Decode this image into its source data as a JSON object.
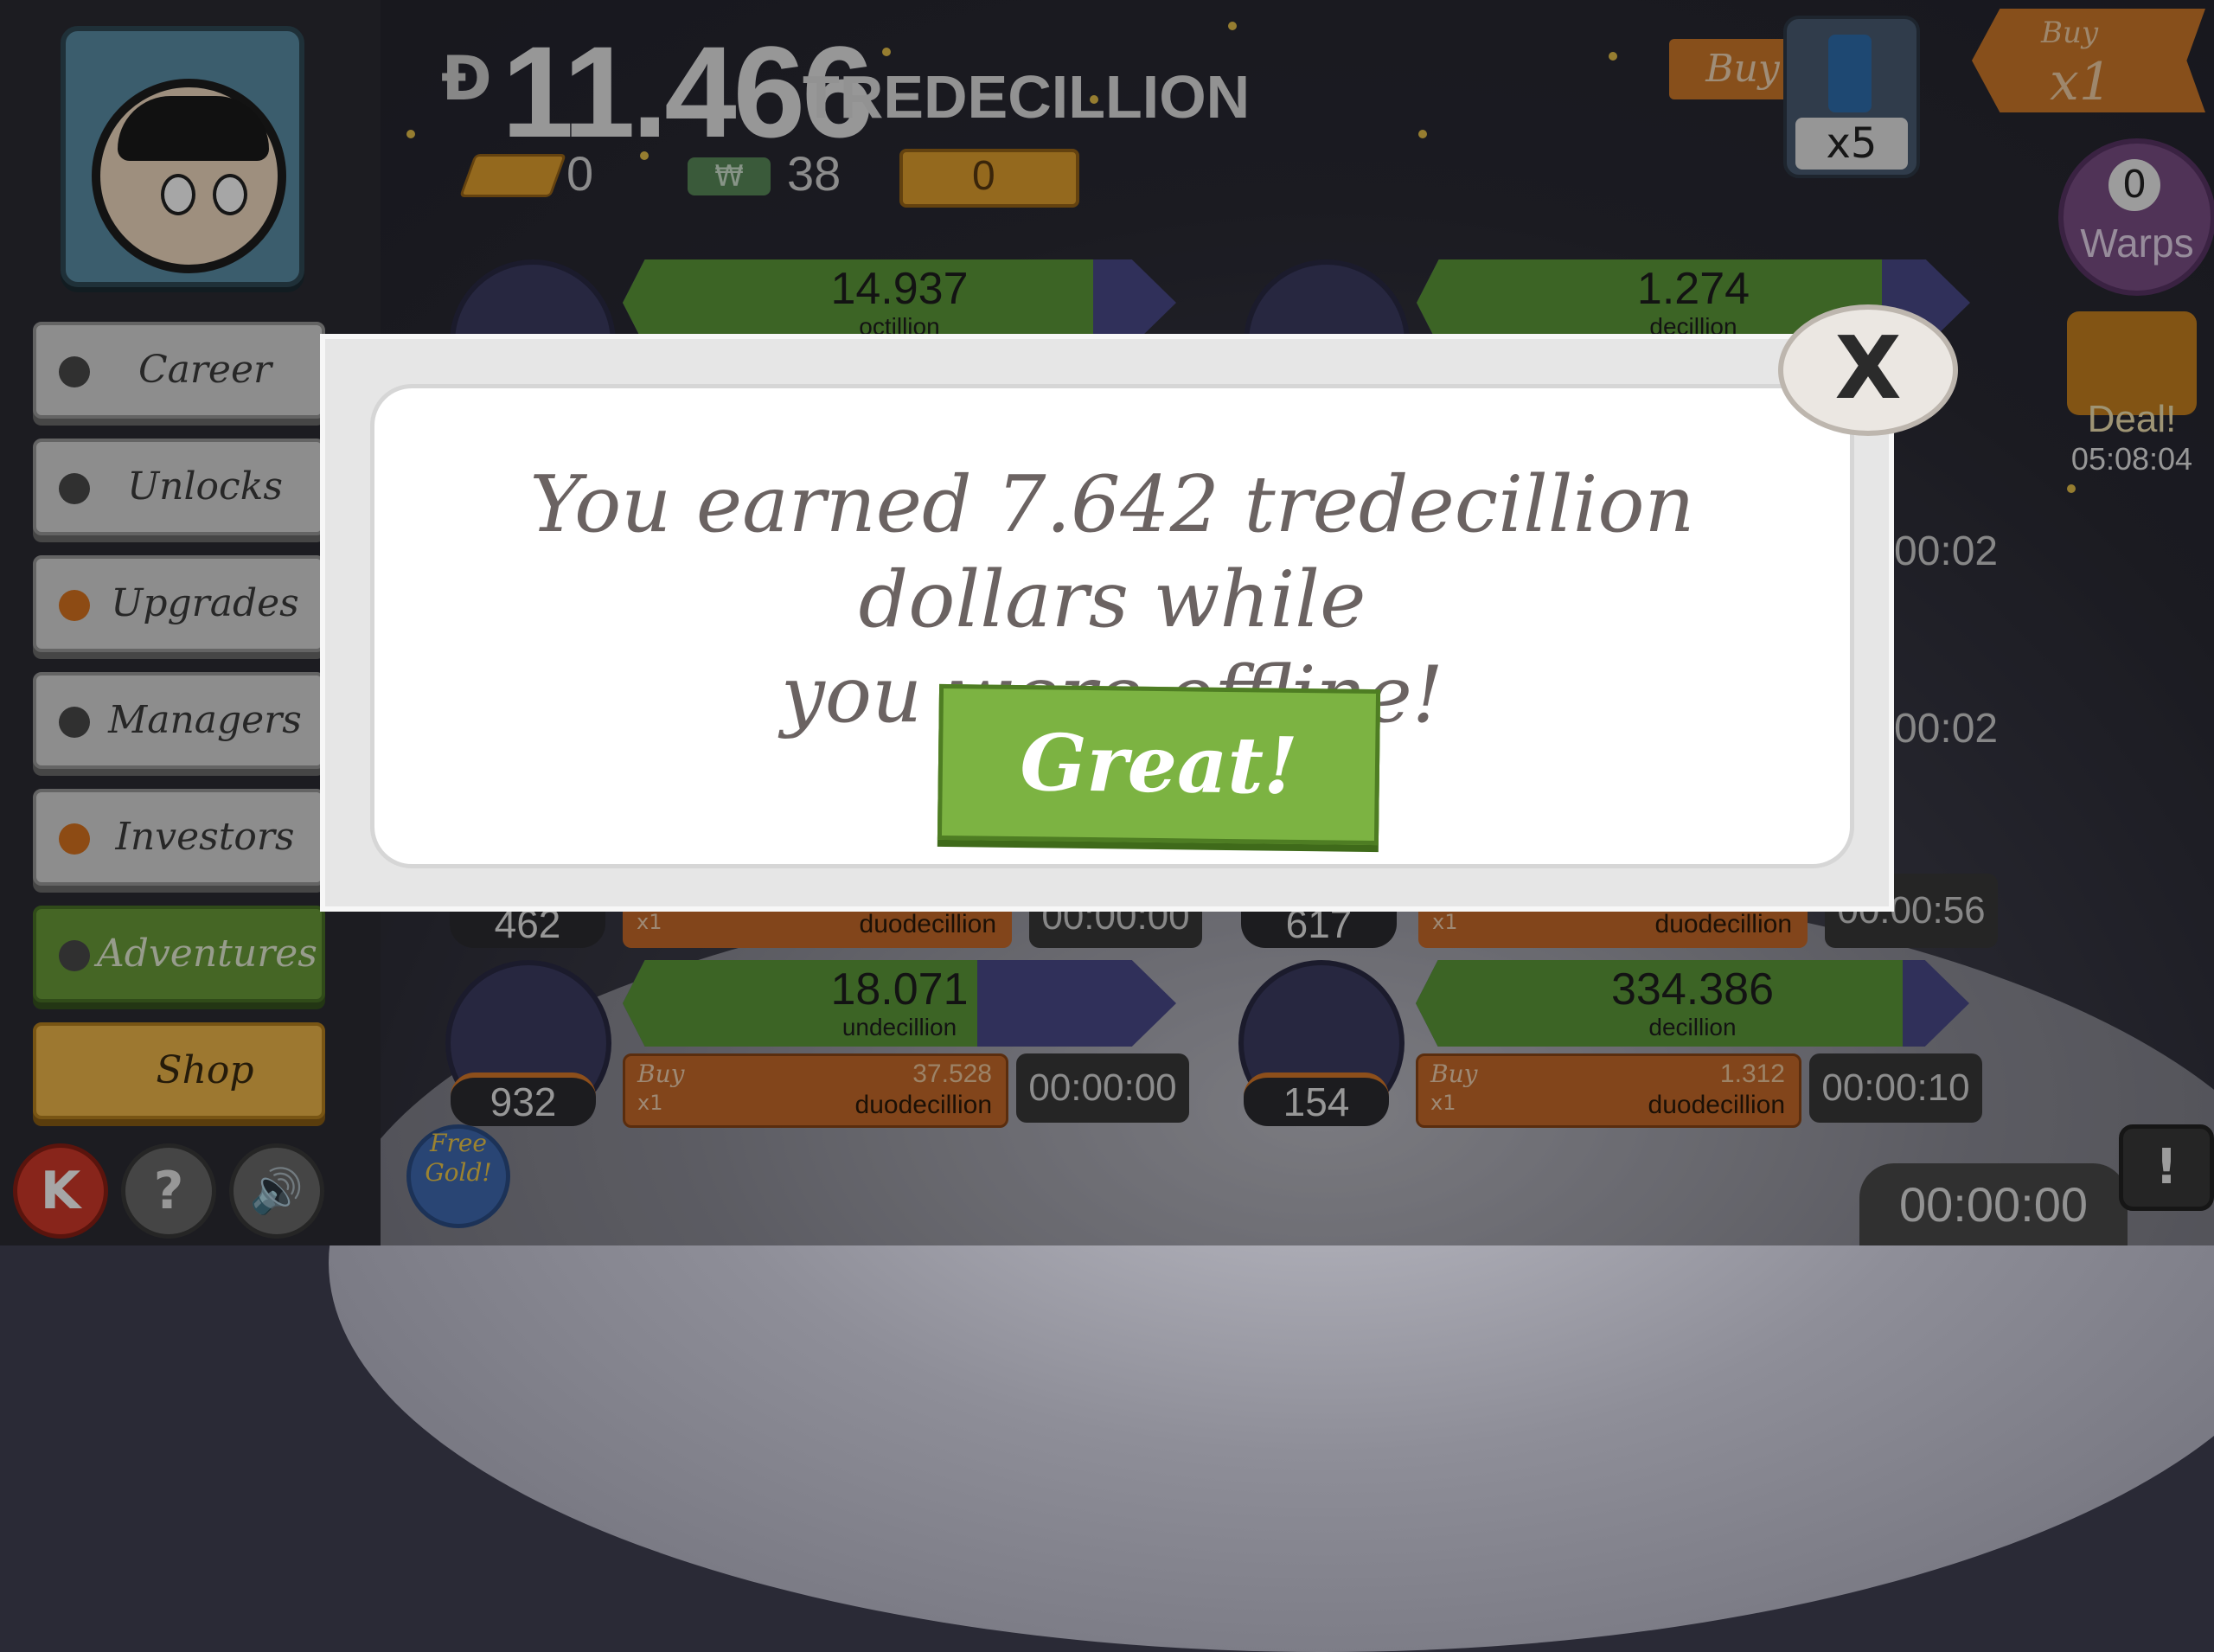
{
  "header": {
    "money_symbol": "Ð",
    "money_value": "11.466",
    "money_unit": "TREDECILLION",
    "gold_count": "0",
    "megabucks_icon_text": "₩",
    "megabucks_count": "38",
    "ticket_count": "0",
    "buy_label": "Buy",
    "multiplier_x5_label": "x5",
    "buy_x1_top": "Buy",
    "buy_x1_bottom": "x1",
    "warps_count": "0",
    "warps_label": "Warps",
    "deal_label": "Deal!",
    "deal_timer": "05:08:04"
  },
  "sidebar": {
    "items": [
      {
        "label": "Career"
      },
      {
        "label": "Unlocks"
      },
      {
        "label": "Upgrades"
      },
      {
        "label": "Managers"
      },
      {
        "label": "Investors"
      },
      {
        "label": "Adventures"
      },
      {
        "label": "Shop"
      }
    ],
    "k_label": "K",
    "help_label": "?",
    "free_gold_label": "Free Gold!"
  },
  "businesses": {
    "top_left": {
      "value": "14.937",
      "unit": "octillion"
    },
    "top_right": {
      "value": "1.274",
      "unit": "decillion"
    },
    "row2_left": {
      "count": "462",
      "buy": "x1",
      "cost_unit": "duodecillion",
      "timer": "00:00:00"
    },
    "row2_right": {
      "count": "617",
      "buy": "x1",
      "cost_unit": "duodecillion",
      "timer": "00:00:56"
    },
    "bottom_left": {
      "count": "932",
      "value": "18.071",
      "unit": "undecillion",
      "buy_top": "Buy",
      "buy_bottom": "x1",
      "cost": "37.528",
      "cost_unit": "duodecillion",
      "timer": "00:00:00"
    },
    "bottom_right": {
      "count": "154",
      "value": "334.386",
      "unit": "decillion",
      "buy_top": "Buy",
      "buy_bottom": "x1",
      "cost": "1.312",
      "cost_unit": "duodecillion",
      "timer": "00:00:10"
    },
    "side_timers": [
      "0",
      "00:02",
      "00:02"
    ]
  },
  "footer": {
    "timer": "00:00:00",
    "tv_icon": "!"
  },
  "modal": {
    "message_line1": "You earned 7.642 tredecillion dollars while",
    "message_line2": "you were offline!",
    "button_label": "Great!",
    "close_label": "X"
  },
  "colors": {
    "accent_green": "#7cb342",
    "accent_orange": "#d07a2a",
    "panel_white": "#ffffff"
  }
}
